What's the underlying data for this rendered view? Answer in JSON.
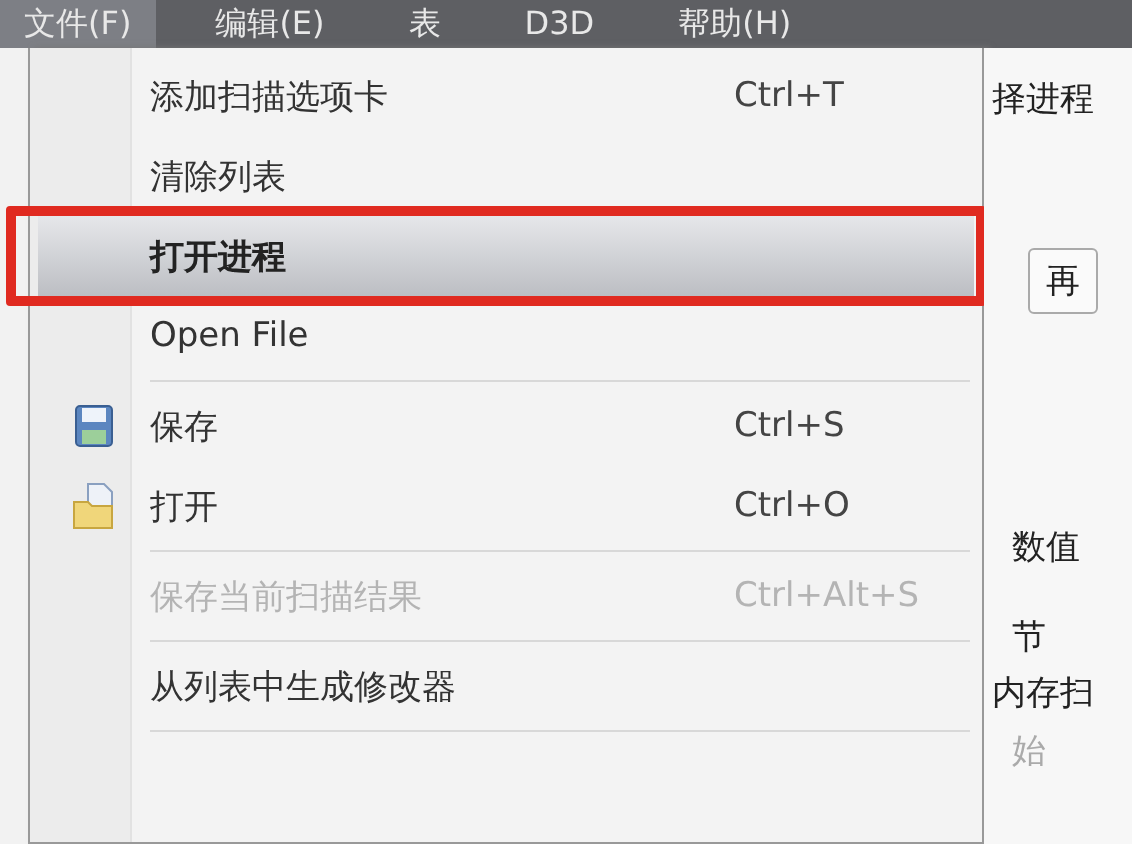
{
  "menu_bar": [
    {
      "label": "文件(F)",
      "selected": true
    },
    {
      "label": "编辑(E)",
      "selected": false
    },
    {
      "label": "表",
      "selected": false
    },
    {
      "label": "D3D",
      "selected": false
    },
    {
      "label": "帮助(H)",
      "selected": false
    }
  ],
  "file_menu": [
    {
      "kind": "item",
      "label": "添加扫描选项卡",
      "shortcut": "Ctrl+T",
      "selected": false,
      "disabled": false
    },
    {
      "kind": "item",
      "label": "清除列表",
      "selected": false,
      "disabled": false
    },
    {
      "kind": "item",
      "label": "打开进程",
      "selected": true,
      "disabled": false
    },
    {
      "kind": "item",
      "label": "Open File",
      "selected": false,
      "disabled": false
    },
    {
      "kind": "separator"
    },
    {
      "kind": "iconitem",
      "label": "保存",
      "shortcut": "Ctrl+S",
      "selected": false,
      "disabled": false
    },
    {
      "kind": "iconitem",
      "label": "打开",
      "shortcut": "Ctrl+O",
      "selected": false,
      "disabled": false
    },
    {
      "kind": "separator"
    },
    {
      "kind": "item",
      "label": "保存当前扫描结果",
      "shortcut": "Ctrl+Alt+S",
      "selected": false,
      "disabled": true
    },
    {
      "kind": "separator"
    },
    {
      "kind": "item",
      "label": "从列表中生成修改器",
      "selected": false,
      "disabled": false
    },
    {
      "kind": "separator"
    }
  ],
  "background_window": {
    "title": "择进程",
    "button": "再",
    "value_type": "数值",
    "size": "节",
    "group": "内存扫",
    "start": "始"
  }
}
